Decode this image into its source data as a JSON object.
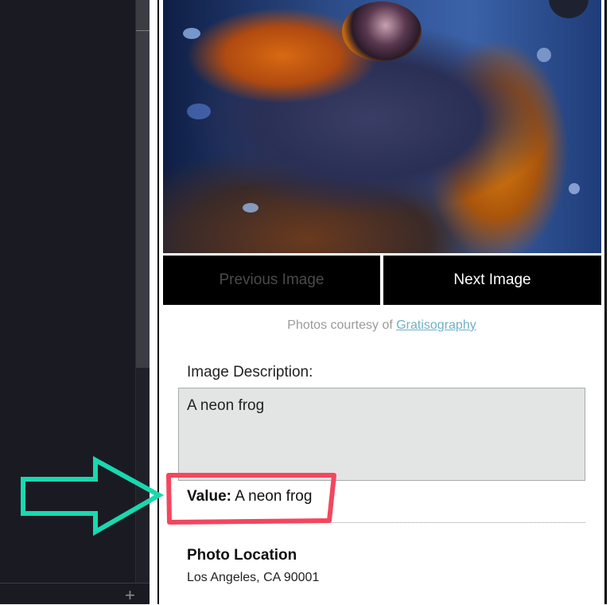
{
  "gallery": {
    "photo_alt": "A neon frog",
    "previous_label": "Previous Image",
    "next_label": "Next Image",
    "credit_prefix": "Photos courtesy of",
    "credit_link": "Gratisography"
  },
  "form": {
    "description_label": "Image Description:",
    "description_value": "A neon frog",
    "value_label": "Value:",
    "value_text": "A neon frog"
  },
  "location": {
    "heading": "Photo Location",
    "address": "Los Angeles, CA 90001"
  },
  "sidebar": {
    "add_icon": "plus-icon"
  },
  "annotations": {
    "arrow_color": "#1ad8b0",
    "highlight_color": "#f4465e"
  }
}
